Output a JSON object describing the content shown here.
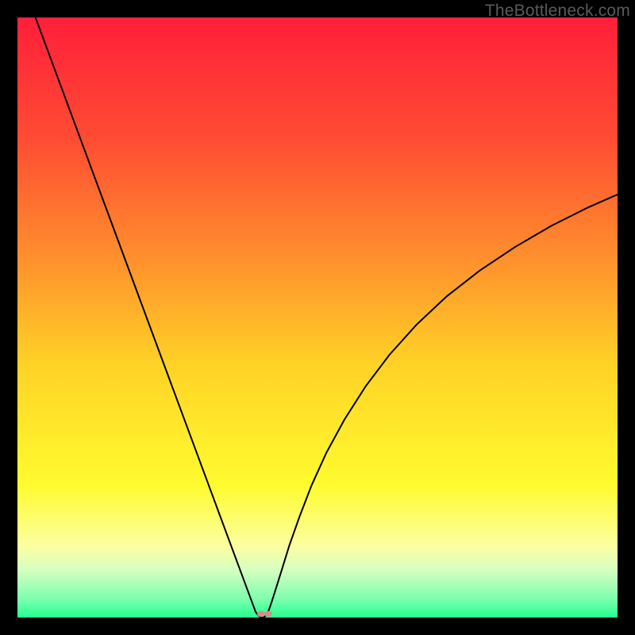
{
  "watermark": "TheBottleneck.com",
  "chart_data": {
    "type": "line",
    "title": "",
    "xlabel": "",
    "ylabel": "",
    "xlim": [
      0,
      100
    ],
    "ylim": [
      0,
      100
    ],
    "background_gradient": {
      "stops": [
        {
          "offset": 0.0,
          "color": "#ff1f3a"
        },
        {
          "offset": 0.2,
          "color": "#ff4b33"
        },
        {
          "offset": 0.4,
          "color": "#ff8f2d"
        },
        {
          "offset": 0.58,
          "color": "#ffd326"
        },
        {
          "offset": 0.78,
          "color": "#fffb2f"
        },
        {
          "offset": 0.88,
          "color": "#fcffa0"
        },
        {
          "offset": 0.92,
          "color": "#d6ffc0"
        },
        {
          "offset": 0.97,
          "color": "#7bffae"
        },
        {
          "offset": 1.0,
          "color": "#23ff90"
        }
      ]
    },
    "series": [
      {
        "name": "bottleneck-curve",
        "color": "#000000",
        "x": [
          3,
          5,
          8,
          11,
          14,
          17,
          20,
          23,
          26,
          29,
          32,
          34.5,
          36.5,
          38,
          39,
          39.7,
          40.2,
          40.6,
          41,
          41.4,
          41.8,
          42.3,
          43,
          44,
          45.3,
          47,
          49,
          51.5,
          54.5,
          58,
          62,
          66.5,
          71.5,
          77,
          83,
          89,
          95,
          100
        ],
        "y": [
          100,
          94.6,
          86.5,
          78.4,
          70.3,
          62.2,
          54.1,
          46.0,
          37.9,
          29.8,
          21.7,
          14.95,
          9.55,
          5.5,
          2.8,
          0.91,
          0.3,
          0.0,
          0.0,
          0.3,
          1.0,
          2.4,
          4.6,
          7.8,
          12.0,
          16.8,
          22.0,
          27.5,
          33.0,
          38.5,
          43.8,
          48.8,
          53.5,
          57.8,
          61.8,
          65.3,
          68.3,
          70.5
        ]
      }
    ],
    "markers": [
      {
        "name": "min-point-a",
        "x": 40.6,
        "y": 0.6,
        "r": 0.65,
        "color": "#d98b8b"
      },
      {
        "name": "min-point-b",
        "x": 41.8,
        "y": 0.6,
        "r": 0.65,
        "color": "#d98b8b"
      }
    ]
  }
}
